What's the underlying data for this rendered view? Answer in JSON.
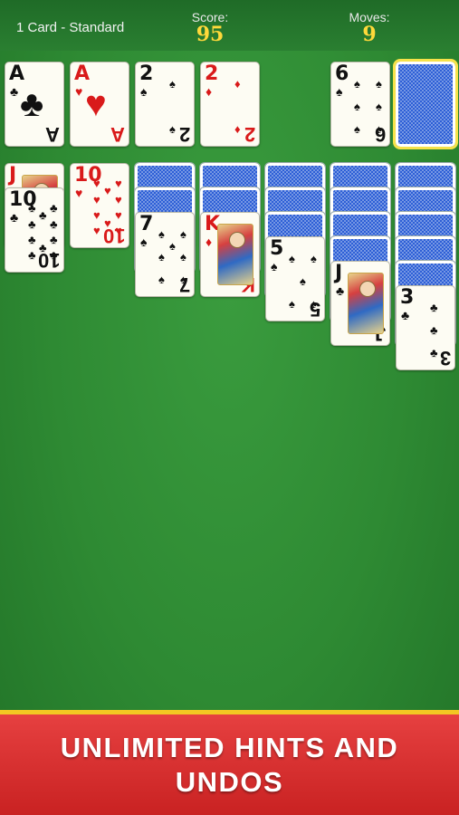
{
  "header": {
    "mode": "1 Card - Standard",
    "score_label": "Score:",
    "score_value": "95",
    "moves_label": "Moves:",
    "moves_value": "9"
  },
  "foundations": [
    {
      "rank": "A",
      "suit": "♣",
      "color": "black"
    },
    {
      "rank": "A",
      "suit": "♥",
      "color": "red"
    },
    {
      "rank": "2",
      "suit": "♠",
      "color": "black"
    },
    {
      "rank": "2",
      "suit": "♦",
      "color": "red"
    }
  ],
  "waste": {
    "rank": "6",
    "suit": "♠",
    "color": "black"
  },
  "stock": {
    "face_down": true
  },
  "tableau": [
    {
      "hidden": 0,
      "cards": [
        {
          "rank": "J",
          "suit": "♦",
          "color": "red"
        },
        {
          "rank": "10",
          "suit": "♣",
          "color": "black"
        }
      ]
    },
    {
      "hidden": 0,
      "cards": [
        {
          "rank": "10",
          "suit": "♥",
          "color": "red"
        }
      ]
    },
    {
      "hidden": 2,
      "cards": [
        {
          "rank": "7",
          "suit": "♠",
          "color": "black"
        }
      ]
    },
    {
      "hidden": 2,
      "cards": [
        {
          "rank": "K",
          "suit": "♦",
          "color": "red"
        }
      ]
    },
    {
      "hidden": 3,
      "cards": [
        {
          "rank": "5",
          "suit": "♠",
          "color": "black"
        }
      ]
    },
    {
      "hidden": 4,
      "cards": [
        {
          "rank": "J",
          "suit": "♣",
          "color": "black"
        }
      ]
    },
    {
      "hidden": 5,
      "cards": [
        {
          "rank": "3",
          "suit": "♣",
          "color": "black"
        }
      ]
    }
  ],
  "banner": {
    "text": "UNLIMITED HINTS AND\nUNDOS"
  },
  "colors": {
    "felt": "#2e8a33",
    "score": "#ffd93a",
    "banner": "#d12b2b",
    "banner_border": "#f3c623",
    "card_back": "#2d5fd6"
  }
}
